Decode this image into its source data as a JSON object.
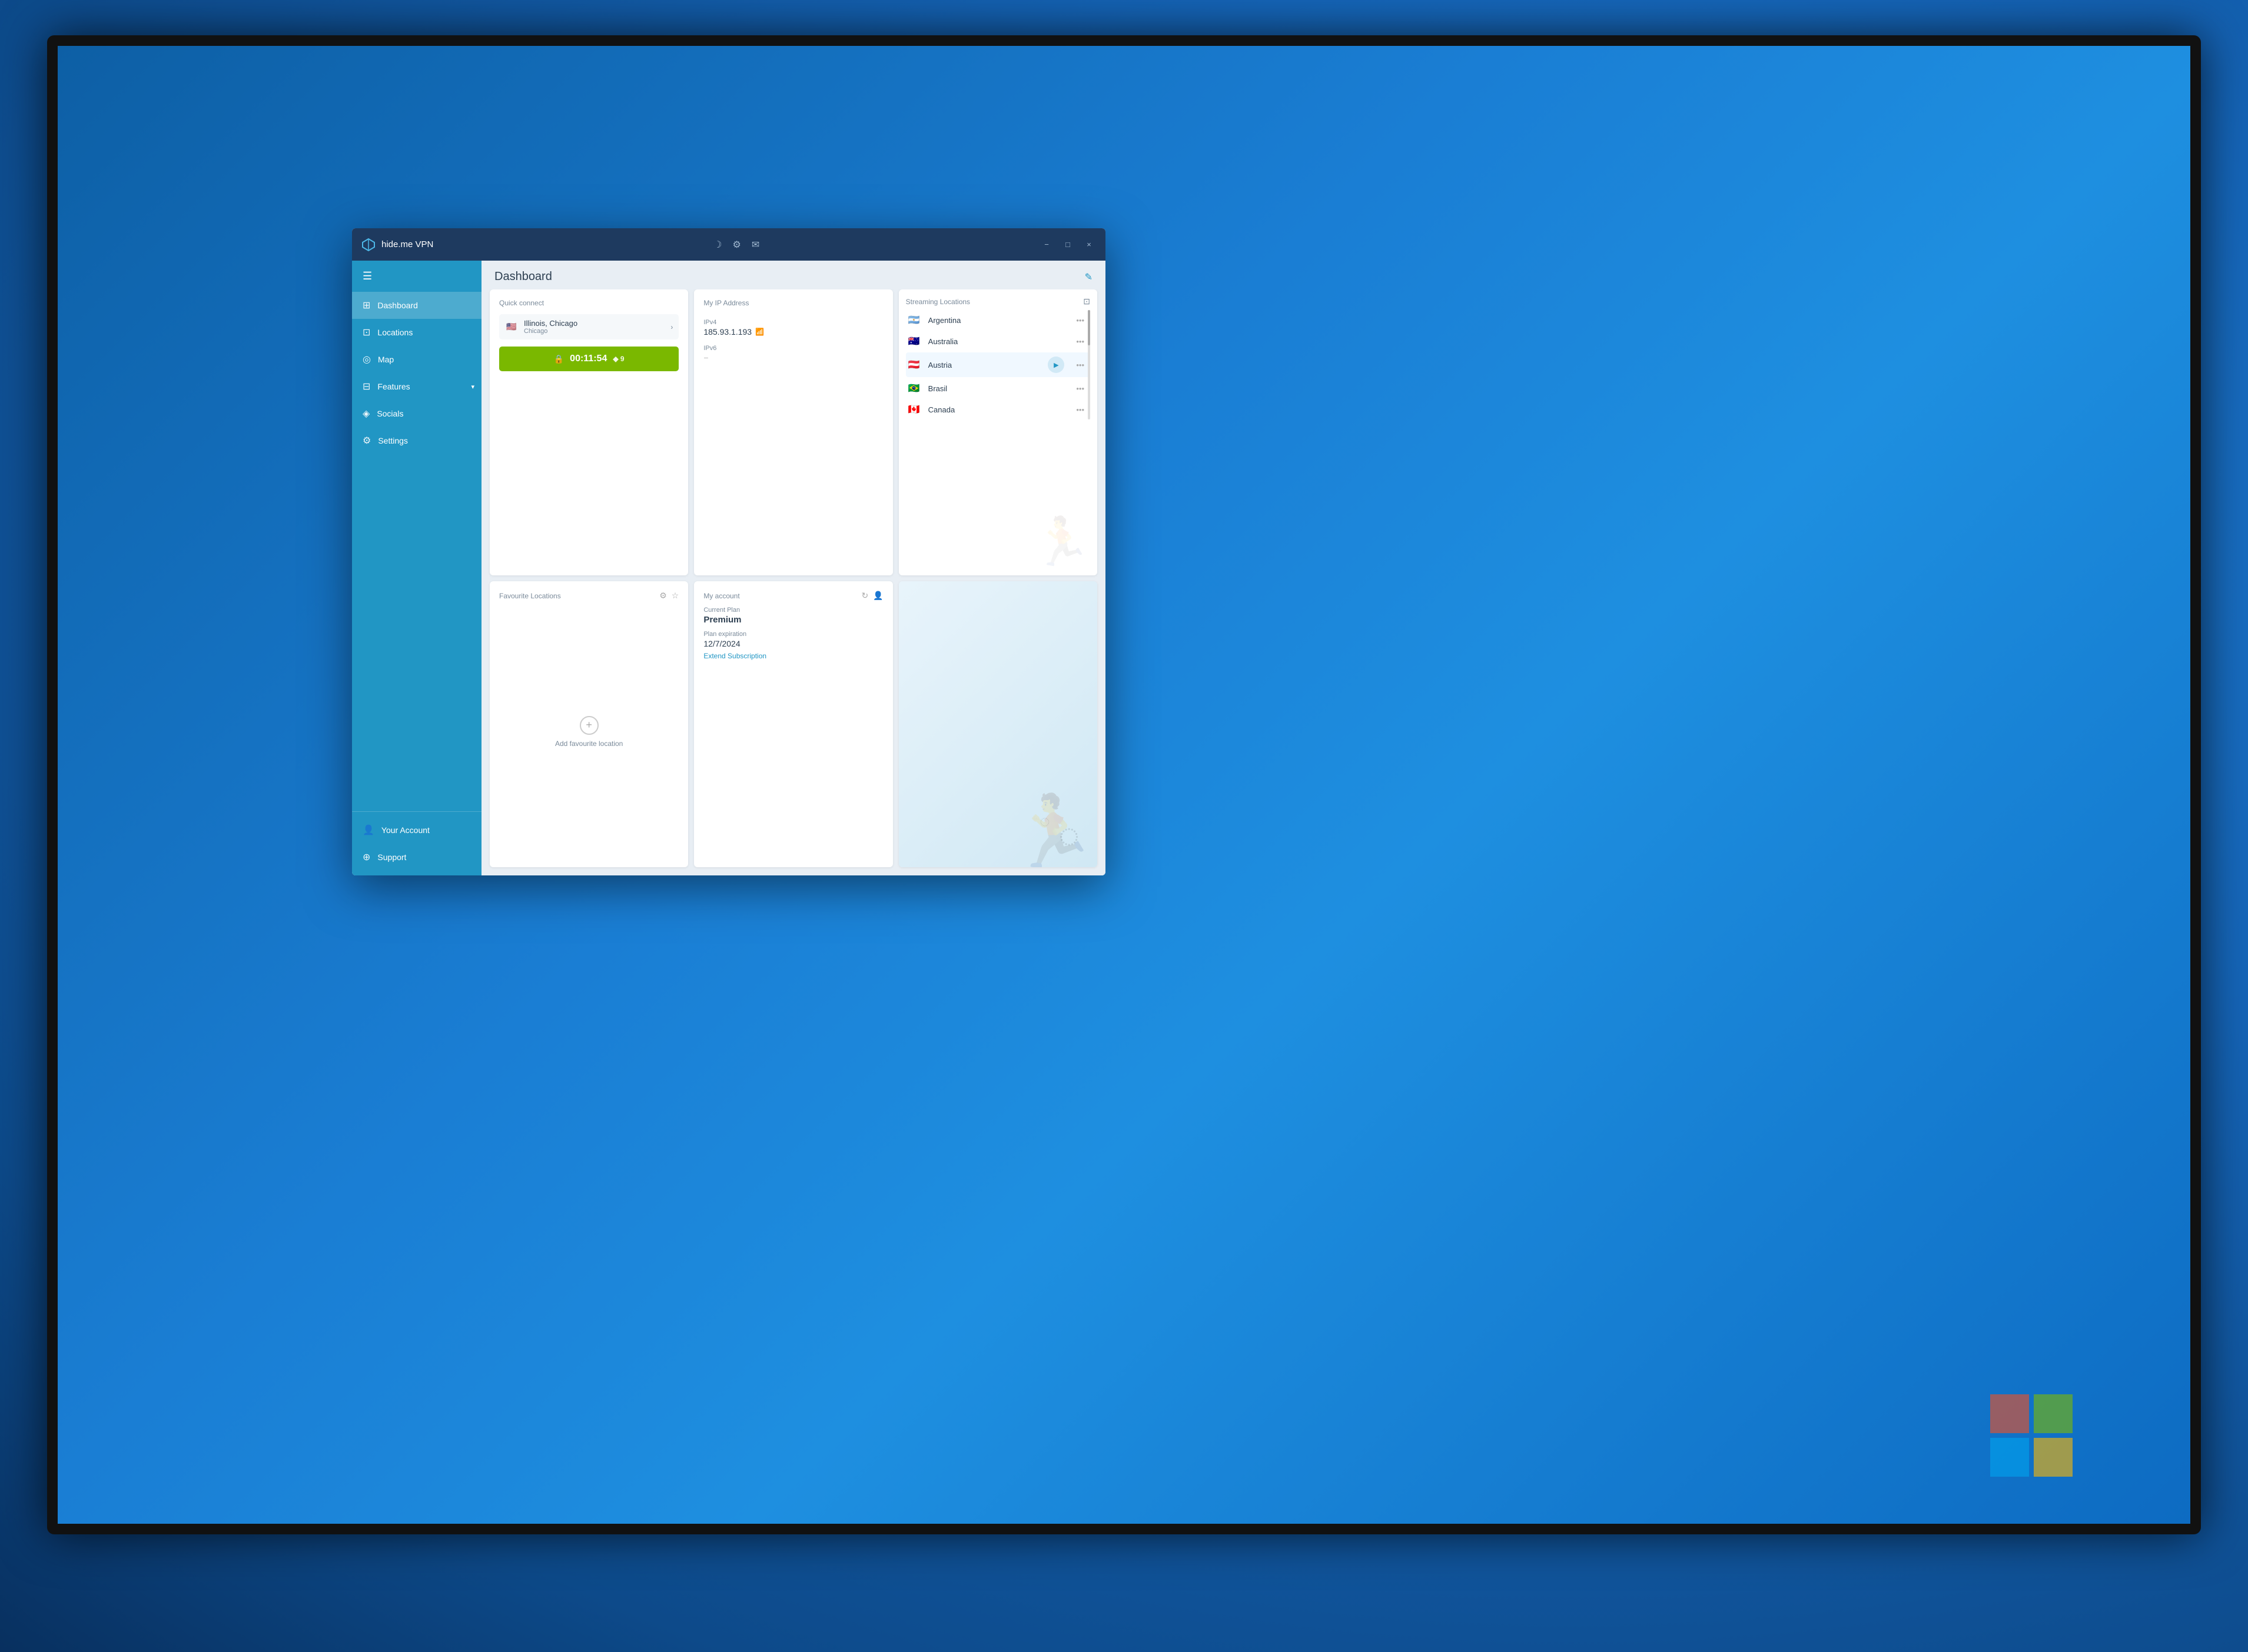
{
  "titleBar": {
    "title": "hide.me VPN",
    "minimize": "−",
    "maximize": "□",
    "close": "×"
  },
  "header": {
    "title": "Dashboard",
    "editIcon": "✎"
  },
  "sidebar": {
    "menuIcon": "☰",
    "items": [
      {
        "id": "dashboard",
        "label": "Dashboard",
        "icon": "⊞",
        "active": true
      },
      {
        "id": "locations",
        "label": "Locations",
        "icon": "⊡"
      },
      {
        "id": "map",
        "label": "Map",
        "icon": "◎"
      },
      {
        "id": "features",
        "label": "Features",
        "icon": "⊟",
        "hasChevron": true
      },
      {
        "id": "socials",
        "label": "Socials",
        "icon": "◈"
      },
      {
        "id": "settings",
        "label": "Settings",
        "icon": "⚙"
      }
    ],
    "bottomItems": [
      {
        "id": "account",
        "label": "Your Account",
        "icon": "👤"
      },
      {
        "id": "support",
        "label": "Support",
        "icon": "⊕"
      }
    ]
  },
  "quickConnect": {
    "title": "Quick connect",
    "location": {
      "city": "Illinois, Chicago",
      "state": "Chicago",
      "flag": "🇺🇸"
    },
    "button": {
      "lock": "🔒",
      "timer": "00:11:54",
      "signal": "◆ 9"
    }
  },
  "myIP": {
    "title": "My IP Address",
    "ipv4Label": "IPv4",
    "ipv4Value": "185.93.1.193",
    "ipv4Flag": "📶",
    "ipv6Label": "IPv6",
    "ipv6Value": "−"
  },
  "streamingLocations": {
    "title": "Streaming Locations",
    "items": [
      {
        "id": "argentina",
        "name": "Argentina",
        "flag": "🇦🇷"
      },
      {
        "id": "australia",
        "name": "Australia",
        "flag": "🇦🇺"
      },
      {
        "id": "austria",
        "name": "Austria",
        "flag": "🇦🇹",
        "hasPlay": true
      },
      {
        "id": "brasil",
        "name": "Brasil",
        "flag": "🇧🇷"
      },
      {
        "id": "canada",
        "name": "Canada",
        "flag": "🇨🇦"
      }
    ],
    "moreLabel": "•••"
  },
  "favouriteLocations": {
    "title": "Favourite Locations",
    "addLabel": "Add favourite location"
  },
  "myAccount": {
    "title": "My account",
    "planLabel": "Current Plan",
    "planValue": "Premium",
    "expiryLabel": "Plan expiration",
    "expiryValue": "12/7/2024",
    "extendLabel": "Extend Subscription"
  }
}
